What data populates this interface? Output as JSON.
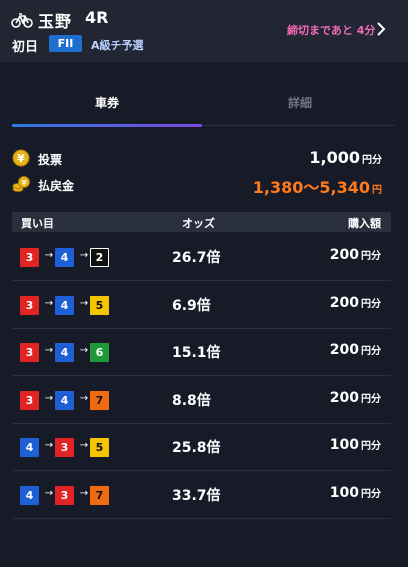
{
  "header": {
    "bike_icon": "bicycle-icon",
    "venue": "玉野",
    "race": "4R",
    "day": "初日",
    "grade": "FII",
    "stage": "A級チ予選",
    "deadline": "締切まであと 4分",
    "chevron_icon": "chevron-right-icon",
    "colors": {
      "background": "#222633",
      "grade": "#1f6fd0",
      "deadline": "#f26ab7"
    }
  },
  "tabs": [
    {
      "label": "車券",
      "active": true
    },
    {
      "label": "詳細",
      "active": false
    }
  ],
  "summary": {
    "bet_label": "投票",
    "bet_value": "1,000",
    "bet_unit": "円分",
    "payout_label": "払戻金",
    "payout_value": "1,380〜5,340",
    "payout_unit": "円",
    "bet_icon": "yen-coin-icon",
    "payout_icon": "coin-stack-icon",
    "colors": {
      "payout": "#ff7a1a"
    }
  },
  "table": {
    "headers": {
      "combo": "買い目",
      "odds": "オッズ",
      "amount": "購入額"
    },
    "rows": [
      {
        "combo": [
          "3",
          "4",
          "2"
        ],
        "odds": "26.7倍",
        "amount": "200",
        "unit": "円分"
      },
      {
        "combo": [
          "3",
          "4",
          "5"
        ],
        "odds": "6.9倍",
        "amount": "200",
        "unit": "円分"
      },
      {
        "combo": [
          "3",
          "4",
          "6"
        ],
        "odds": "15.1倍",
        "amount": "200",
        "unit": "円分"
      },
      {
        "combo": [
          "3",
          "4",
          "7"
        ],
        "odds": "8.8倍",
        "amount": "200",
        "unit": "円分"
      },
      {
        "combo": [
          "4",
          "3",
          "5"
        ],
        "odds": "25.8倍",
        "amount": "100",
        "unit": "円分"
      },
      {
        "combo": [
          "4",
          "3",
          "7"
        ],
        "odds": "33.7倍",
        "amount": "100",
        "unit": "円分"
      }
    ]
  },
  "bike_colors": {
    "2": {
      "bg": "#111111",
      "fg": "#ffffff",
      "border": "#ffffff"
    },
    "3": {
      "bg": "#e02424",
      "fg": "#ffffff",
      "border": "#e02424"
    },
    "4": {
      "bg": "#1e5fd6",
      "fg": "#ffffff",
      "border": "#1e5fd6"
    },
    "5": {
      "bg": "#f2c500",
      "fg": "#111111",
      "border": "#f2c500"
    },
    "6": {
      "bg": "#1f9a3a",
      "fg": "#ffffff",
      "border": "#1f9a3a"
    },
    "7": {
      "bg": "#ef6b12",
      "fg": "#111111",
      "border": "#ef6b12"
    }
  },
  "combo_arrow": "→"
}
